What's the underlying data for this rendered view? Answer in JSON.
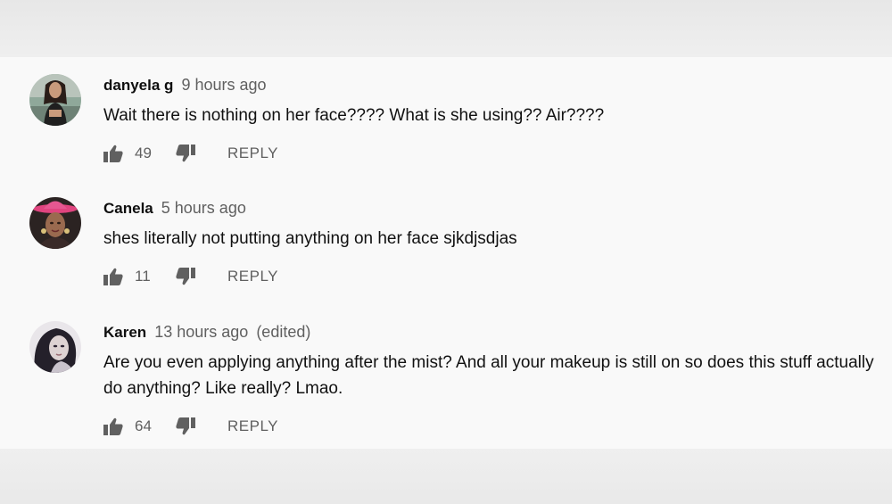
{
  "comments": [
    {
      "author": "danyela g",
      "time": "9 hours ago",
      "edited": "",
      "text": "Wait there is nothing on her face???? What is she using?? Air????",
      "likes": "49",
      "reply_label": "REPLY",
      "avatar": "avatar-woman-sitting"
    },
    {
      "author": "Canela",
      "time": "5 hours ago",
      "edited": "",
      "text": "shes literally not putting anything on her face sjkdjsdjas",
      "likes": "11",
      "reply_label": "REPLY",
      "avatar": "avatar-woman-pink-hat"
    },
    {
      "author": "Karen",
      "time": "13 hours ago",
      "edited": "(edited)",
      "text": "Are you even applying anything after the mist? And all your makeup is still on so does this stuff actually do anything? Like really? Lmao.",
      "likes": "64",
      "reply_label": "REPLY",
      "avatar": "avatar-woman-dark-hair"
    }
  ],
  "colors": {
    "panel_bg": "#f9f9f9",
    "band_bg": "#ececec",
    "author": "#0f0f0f",
    "meta": "#606060",
    "text": "#111111",
    "icon": "#606060"
  },
  "icons": {
    "like": "thumb-up-icon",
    "dislike": "thumb-down-icon"
  }
}
